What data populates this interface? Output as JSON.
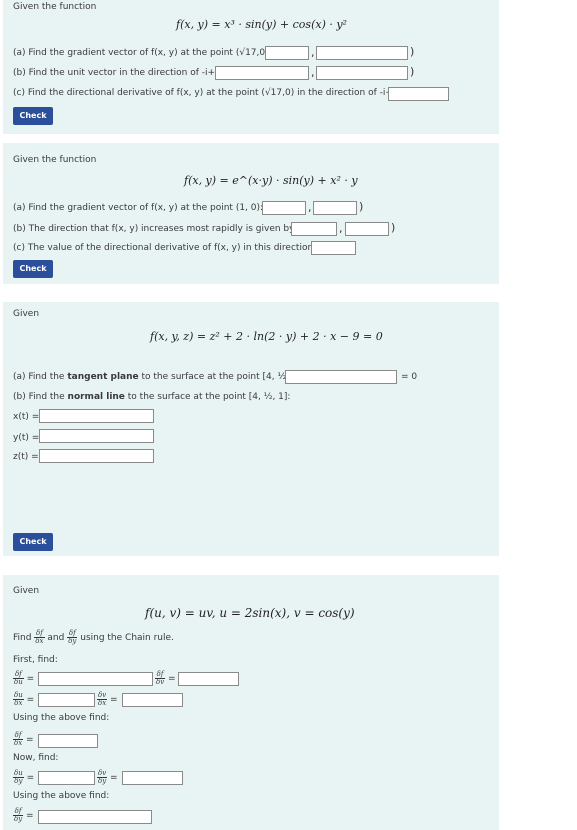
{
  "p1": {
    "intro": "Given the function",
    "formula_lhs": "f(x, y) =",
    "formula_rhs": "x³ · sin(y) + cos(x) · y²",
    "qa": "(a) Find the gradient vector of f(x, y) at the point (√17,0): (",
    "qb": "(b) Find the unit vector in the direction of -i+4j: (",
    "qc": "(c) Find the directional derivative of f(x, y) at the point (√17,0) in the direction of -i+4j:",
    "check": "Check"
  },
  "p2": {
    "intro": "Given the function",
    "formula": "f(x, y) = e^(x·y) · sin(y) + x² · y",
    "qa": "(a) Find the gradient vector of f(x, y) at the point (1, 0): (",
    "qb": "(b) The direction that f(x, y) increases most rapidly is given by: (",
    "qc": "(c) The value of the directional derivative of f(x, y) in this direction is:",
    "check": "Check"
  },
  "p3": {
    "intro": "Given",
    "formula": "f(x, y, z) = z² + 2 · ln(2 · y) + 2 · x − 9 = 0",
    "qa_pre": "(a) Find the ",
    "qa_bold": "tangent plane",
    "qa_post": " to the surface at the point [4, ½, 1]:",
    "eq_zero": "= 0",
    "qb_pre": "(b) Find the ",
    "qb_bold": "normal line",
    "qb_post": " to the surface at the point [4, ½, 1]:",
    "x_label": "x(t) =",
    "y_label": "y(t) =",
    "z_label": "z(t) =",
    "check": "Check"
  },
  "p4": {
    "intro": "Given",
    "formula": "f(u, v) = uv,  u = 2sin(x),  v = cos(y)",
    "find_pre": "Find",
    "find_and": "and",
    "find_post": "using the Chain rule.",
    "first_find": "First, find:",
    "using_above_1": "Using the above find:",
    "now_find": "Now, find:",
    "using_above_2": "Using the above find:",
    "eq": "=",
    "df": "δf",
    "du_num": "δu",
    "dv_num": "δv",
    "d_u": "δu",
    "d_v": "δv",
    "d_x": "δx",
    "d_y": "δy"
  }
}
